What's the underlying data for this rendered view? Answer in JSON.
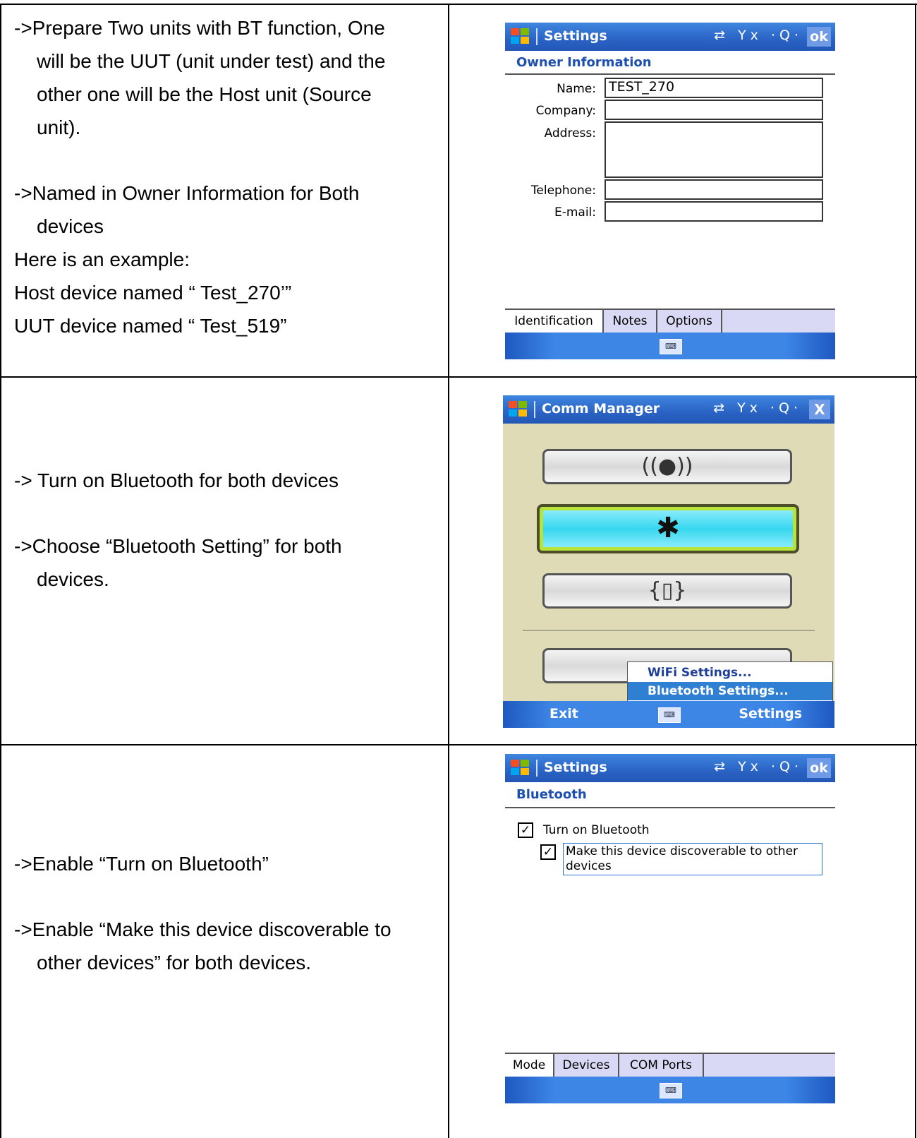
{
  "row1": {
    "text": {
      "p1_line1": "->Prepare Two units with BT function, One",
      "p1_line2": "will be the UUT (unit under test) and the",
      "p1_line3": "other one will be the Host unit (Source",
      "p1_line4": "unit).",
      "p2_line1": "->Named in Owner Information for Both",
      "p2_line2": "devices",
      "p3": "Here is an example:",
      "p4": "Host device named “ Test_270’”",
      "p5": "UUT device named “ Test_519”"
    },
    "screen": {
      "title": "Settings",
      "ok_label": "ok",
      "status_icons": "⇄ Yx ·Q·",
      "heading": "Owner Information",
      "fields": {
        "name_label": "Name:",
        "name_value": "TEST_270",
        "company_label": "Company:",
        "address_label": "Address:",
        "telephone_label": "Telephone:",
        "email_label": "E-mail:"
      },
      "tabs": [
        "Identification",
        "Notes",
        "Options"
      ]
    }
  },
  "row2": {
    "text": {
      "p1": "-> Turn on Bluetooth for both devices",
      "p2_line1": "->Choose “Bluetooth Setting” for both",
      "p2_line2": "devices."
    },
    "screen": {
      "title": "Comm Manager",
      "close_label": "X",
      "status_icons": "⇄ Yx ·Q·",
      "buttons": [
        "wireless",
        "bluetooth",
        "phone",
        "other"
      ],
      "menu": [
        "WiFi Settings...",
        "Bluetooth Settings..."
      ],
      "softkeys": {
        "left": "Exit",
        "right": "Settings"
      }
    }
  },
  "row3": {
    "text": {
      "p1": "->Enable “Turn on Bluetooth”",
      "p2_line1": "->Enable “Make this device discoverable to",
      "p2_line2": "other devices” for both devices."
    },
    "screen": {
      "title": "Settings",
      "ok_label": "ok",
      "status_icons": "⇄ Yx ·Q·",
      "heading": "Bluetooth",
      "checkbox1": "Turn on Bluetooth",
      "checkbox2_line1": "Make this device discoverable to other",
      "checkbox2_line2": "devices",
      "tabs": [
        "Mode",
        "Devices",
        "COM Ports"
      ]
    }
  }
}
